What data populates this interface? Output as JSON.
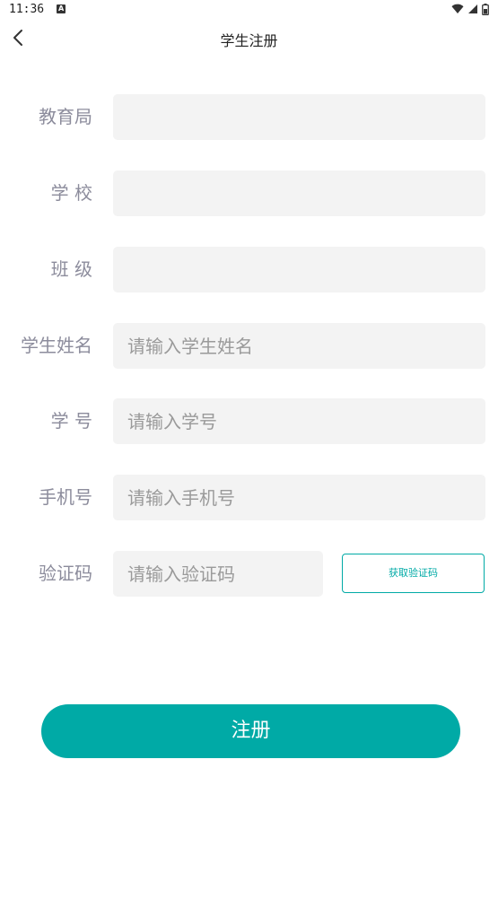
{
  "status_bar": {
    "time": "11:36",
    "notification_icon": "A",
    "icons": [
      "wifi-icon",
      "signal-icon",
      "battery-icon"
    ]
  },
  "header": {
    "title": "学生注册",
    "back_icon": "chevron-left-icon"
  },
  "form": {
    "education_bureau": {
      "label": "教育局",
      "value": "",
      "placeholder": ""
    },
    "school": {
      "label": "学 校",
      "value": "",
      "placeholder": ""
    },
    "class": {
      "label": "班 级",
      "value": "",
      "placeholder": ""
    },
    "student_name": {
      "label": "学生姓名",
      "value": "",
      "placeholder": "请输入学生姓名"
    },
    "student_id": {
      "label": "学 号",
      "value": "",
      "placeholder": "请输入学号"
    },
    "phone": {
      "label": "手机号",
      "value": "",
      "placeholder": "请输入手机号"
    },
    "verification_code": {
      "label": "验证码",
      "value": "",
      "placeholder": "请输入验证码"
    },
    "get_code_label": "获取验证码"
  },
  "submit_label": "注册",
  "colors": {
    "accent": "#00aaa6",
    "input_bg": "#f3f3f3",
    "label": "#8c8c9c"
  }
}
